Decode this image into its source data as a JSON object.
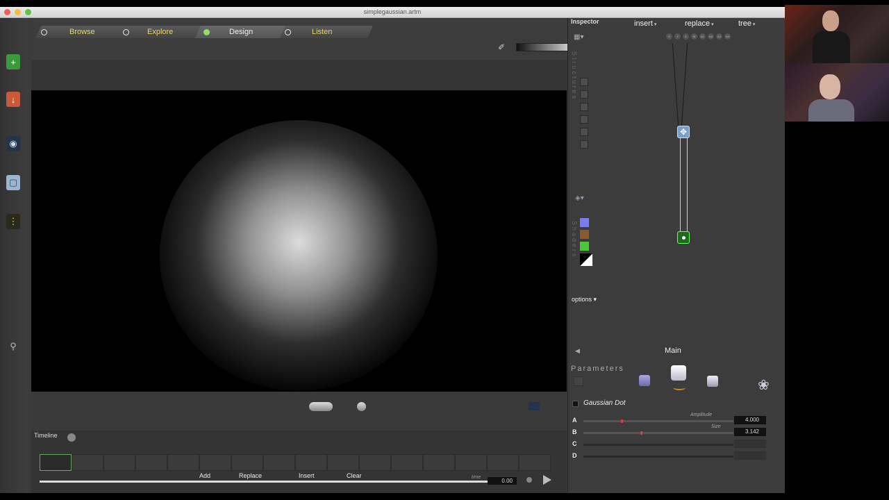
{
  "window": {
    "title": "simplegaussian.artm"
  },
  "modes": [
    {
      "label": "Browse",
      "active": false
    },
    {
      "label": "Explore",
      "active": false
    },
    {
      "label": "Design",
      "active": true
    },
    {
      "label": "Listen",
      "active": false
    }
  ],
  "left_toolbar": [
    "add-icon",
    "download-icon",
    "eye-icon",
    "image-icon",
    "filmstrip-icon",
    "help-icon"
  ],
  "timeline": {
    "label": "Timeline",
    "buttons": {
      "add": "Add",
      "replace": "Replace",
      "insert": "Insert",
      "clear": "Clear"
    },
    "time_label": "time",
    "time_value": "0.00"
  },
  "inspector": {
    "title": "Inspector",
    "menus": {
      "insert": "insert",
      "replace": "replace",
      "tree": "tree"
    },
    "chips": [
      "X",
      "Y",
      "Z",
      "W",
      "A1",
      "A2",
      "A3",
      "A4"
    ],
    "structures_label": "Structures",
    "shaders_label": "Shaders",
    "options": "options",
    "main": "Main",
    "parameters_title": "Parameters",
    "shader_name": "Gaussian Dot",
    "params": [
      {
        "label": "A",
        "caption": "Amplitude",
        "value": "4.000"
      },
      {
        "label": "B",
        "caption": "Size",
        "value": "3.142"
      },
      {
        "label": "C",
        "caption": "",
        "value": ""
      },
      {
        "label": "D",
        "caption": "",
        "value": ""
      }
    ],
    "swatch_colors": [
      "#7b7bf0",
      "#8a5a2a",
      "#4ac83a"
    ]
  },
  "colors": {
    "accent": "#8fdf6a",
    "mode_text": "#e8d86a"
  }
}
